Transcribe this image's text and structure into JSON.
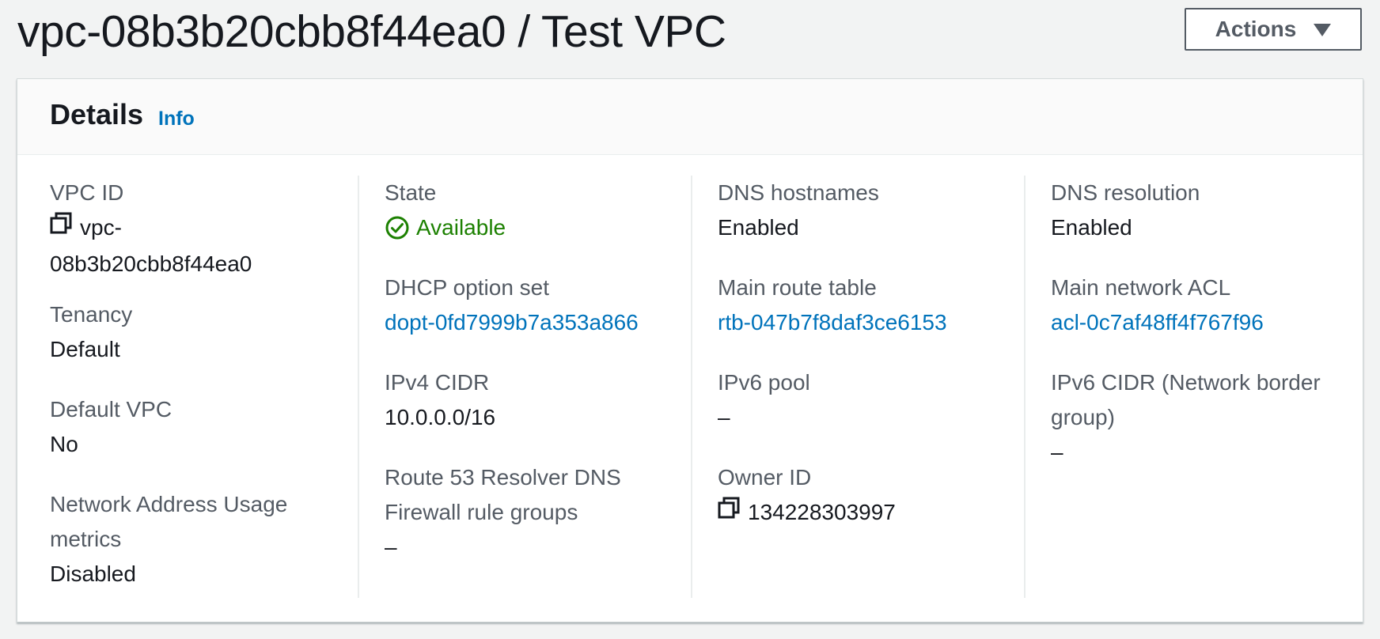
{
  "header": {
    "title": "vpc-08b3b20cbb8f44ea0 / Test VPC",
    "actions_label": "Actions"
  },
  "details": {
    "title": "Details",
    "info_label": "Info",
    "col1": {
      "vpc_id_label": "VPC ID",
      "vpc_id_value_line1": "vpc-",
      "vpc_id_value_line2": "08b3b20cbb8f44ea0",
      "tenancy_label": "Tenancy",
      "tenancy_value": "Default",
      "default_vpc_label": "Default VPC",
      "default_vpc_value": "No",
      "nau_label_line1": "Network Address Usage",
      "nau_label_line2": "metrics",
      "nau_value": "Disabled"
    },
    "col2": {
      "state_label": "State",
      "state_value": "Available",
      "dhcp_label": "DHCP option set",
      "dhcp_value": "dopt-0fd7999b7a353a866",
      "ipv4_label": "IPv4 CIDR",
      "ipv4_value": "10.0.0.0/16",
      "r53_label_line1": "Route 53 Resolver DNS",
      "r53_label_line2": "Firewall rule groups",
      "r53_value": "–"
    },
    "col3": {
      "dns_hostnames_label": "DNS hostnames",
      "dns_hostnames_value": "Enabled",
      "main_rtb_label": "Main route table",
      "main_rtb_value": "rtb-047b7f8daf3ce6153",
      "ipv6_pool_label": "IPv6 pool",
      "ipv6_pool_value": "–",
      "owner_id_label": "Owner ID",
      "owner_id_value": "134228303997"
    },
    "col4": {
      "dns_resolution_label": "DNS resolution",
      "dns_resolution_value": "Enabled",
      "main_acl_label": "Main network ACL",
      "main_acl_value": "acl-0c7af48ff4f767f96",
      "ipv6_cidr_label_line1": "IPv6 CIDR (Network border",
      "ipv6_cidr_label_line2": "group)",
      "ipv6_cidr_value": "–"
    }
  },
  "colors": {
    "link": "#0073bb",
    "success": "#1d8102",
    "label": "#545b64",
    "text": "#16191f"
  },
  "icons": {
    "copy": "copy-icon",
    "status": "check-circle-icon",
    "dropdown": "caret-down-icon"
  }
}
